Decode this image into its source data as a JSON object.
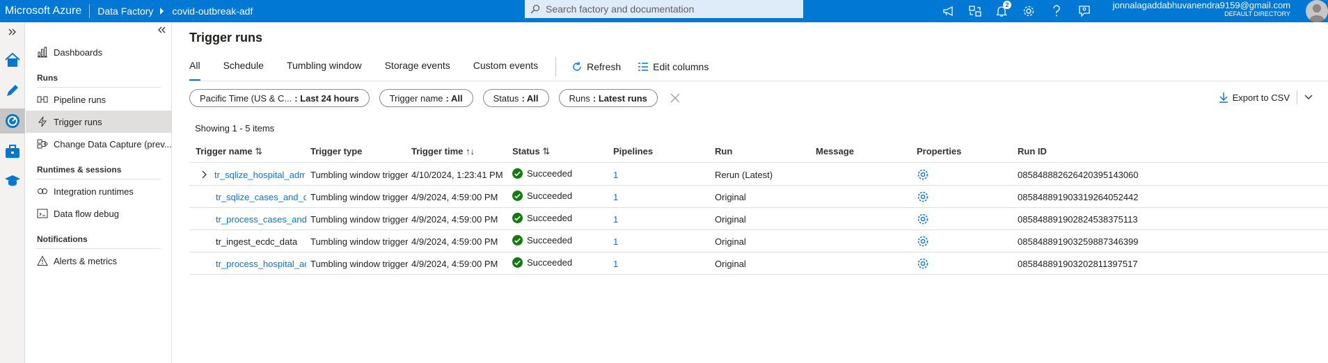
{
  "topbar": {
    "brand": "Microsoft Azure",
    "crumb1": "Data Factory",
    "crumb2": "covid-outbreak-adf",
    "search_placeholder": "Search factory and documentation",
    "notification_count": "2",
    "user_email": "jonnalagaddabhuvanendra9159@gmail.com",
    "user_directory": "DEFAULT DIRECTORY"
  },
  "nav": {
    "dashboards": "Dashboards",
    "runs_header": "Runs",
    "pipeline_runs": "Pipeline runs",
    "trigger_runs": "Trigger runs",
    "cdc": "Change Data Capture (prev...",
    "runtimes_header": "Runtimes & sessions",
    "integration_runtimes": "Integration runtimes",
    "dataflow_debug": "Data flow debug",
    "notifications_header": "Notifications",
    "alerts": "Alerts & metrics"
  },
  "page": {
    "title": "Trigger runs",
    "tabs": [
      "All",
      "Schedule",
      "Tumbling window",
      "Storage events",
      "Custom events"
    ],
    "refresh": "Refresh",
    "edit_columns": "Edit columns",
    "export": "Export to CSV",
    "showing": "Showing 1 - 5 items"
  },
  "filters": [
    {
      "label": "Pacific Time (US & C...",
      "value": ": Last 24 hours"
    },
    {
      "label": "Trigger name",
      "value": ": All"
    },
    {
      "label": "Status",
      "value": ": All"
    },
    {
      "label": "Runs",
      "value": ": Latest runs"
    }
  ],
  "columns": [
    "Trigger name",
    "Trigger type",
    "Trigger time",
    "Status",
    "Pipelines",
    "Run",
    "Message",
    "Properties",
    "Run ID"
  ],
  "rows": [
    {
      "name": "tr_sqlize_hospital_admis...",
      "type": "Tumbling window trigger",
      "time": "4/10/2024, 1:23:41 PM",
      "status": "Succeeded",
      "pipelines": "1",
      "run": "Rerun (Latest)",
      "runid": "085848882626420395143060"
    },
    {
      "name": "tr_sqlize_cases_and_de...",
      "type": "Tumbling window trigger",
      "time": "4/9/2024, 4:59:00 PM",
      "status": "Succeeded",
      "pipelines": "1",
      "run": "Original",
      "runid": "085848891903319264052442"
    },
    {
      "name": "tr_process_cases_and_...",
      "type": "Tumbling window trigger",
      "time": "4/9/2024, 4:59:00 PM",
      "status": "Succeeded",
      "pipelines": "1",
      "run": "Original",
      "runid": "085848891902824538375113"
    },
    {
      "name": "tr_ingest_ecdc_data",
      "type": "Tumbling window trigger",
      "time": "4/9/2024, 4:59:00 PM",
      "status": "Succeeded",
      "pipelines": "1",
      "run": "Original",
      "runid": "085848891903259887346399"
    },
    {
      "name": "tr_process_hospital_ad...",
      "type": "Tumbling window trigger",
      "time": "4/9/2024, 4:59:00 PM",
      "status": "Succeeded",
      "pipelines": "1",
      "run": "Original",
      "runid": "085848891903202811397517"
    }
  ],
  "colors": {
    "accent": "#0078d4",
    "success": "#107c10"
  }
}
